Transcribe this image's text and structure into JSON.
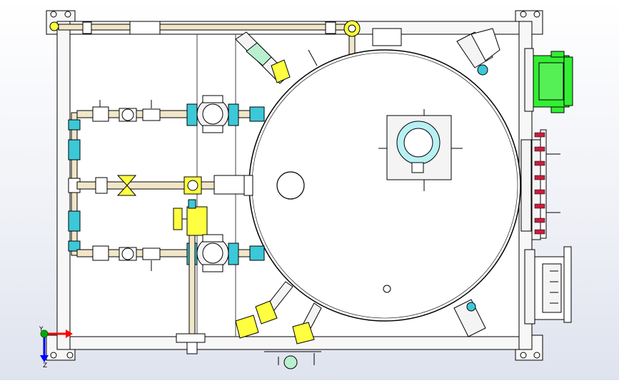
{
  "axis_triad": {
    "y_label": "Y",
    "z_label": "Z"
  },
  "colors": {
    "frame": "#f4f4f4",
    "outline": "#000000",
    "pipe": "#f1e6c8",
    "fitting_cyan": "#3cc8d8",
    "valve_yellow": "#ffff40",
    "motor_green": "#33ee33",
    "bolt_red": "#c81e3c",
    "axis_y": "#00aa00",
    "axis_x": "#ff0000",
    "axis_z": "#0000ff"
  }
}
